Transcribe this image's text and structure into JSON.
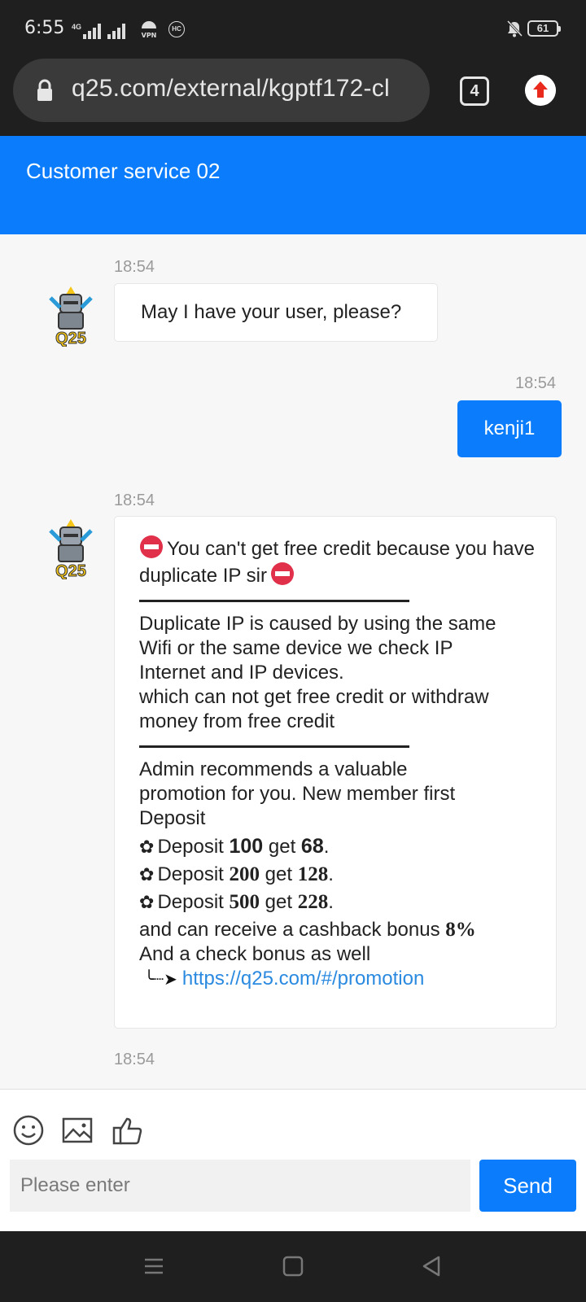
{
  "status_bar": {
    "time": "6:55",
    "network": "4G",
    "vpn": "VPN",
    "hc": "HC",
    "battery": "61"
  },
  "browser": {
    "url": "q25.com/external/kgptf172-cl",
    "tab_count": "4"
  },
  "header": {
    "title": "Customer service 02"
  },
  "messages": [
    {
      "time": "18:54",
      "text": "May I have your user, please?"
    },
    {
      "time": "18:54",
      "text": "kenji1"
    },
    {
      "time": "18:54",
      "line1": "You can't get free credit because you have duplicate IP sir",
      "para2": [
        "Duplicate IP is caused by using the same",
        "Wifi or the same device we check IP",
        "Internet and IP devices.",
        "which can not get free credit or withdraw",
        "money from free credit"
      ],
      "para3": [
        "Admin recommends a valuable",
        "promotion for you. New member first",
        "Deposit"
      ],
      "promos": [
        {
          "label": "Deposit",
          "amount": "100",
          "get": "get",
          "bonus": "68"
        },
        {
          "label": "Deposit",
          "amount": "200",
          "get": "get",
          "bonus": "128"
        },
        {
          "label": "Deposit",
          "amount": "500",
          "get": "get",
          "bonus": "228"
        }
      ],
      "cashback_line": "and can receive a cashback bonus",
      "cashback_value": "8%",
      "check_line": "And a check bonus as well",
      "link": "https://q25.com/#/promotion"
    },
    {
      "time": "18:54"
    }
  ],
  "input": {
    "placeholder": "Please enter",
    "send_label": "Send"
  },
  "colors": {
    "accent": "#0a7cfc",
    "link": "#2a8ae0",
    "system_bar": "#1f1f1f"
  }
}
